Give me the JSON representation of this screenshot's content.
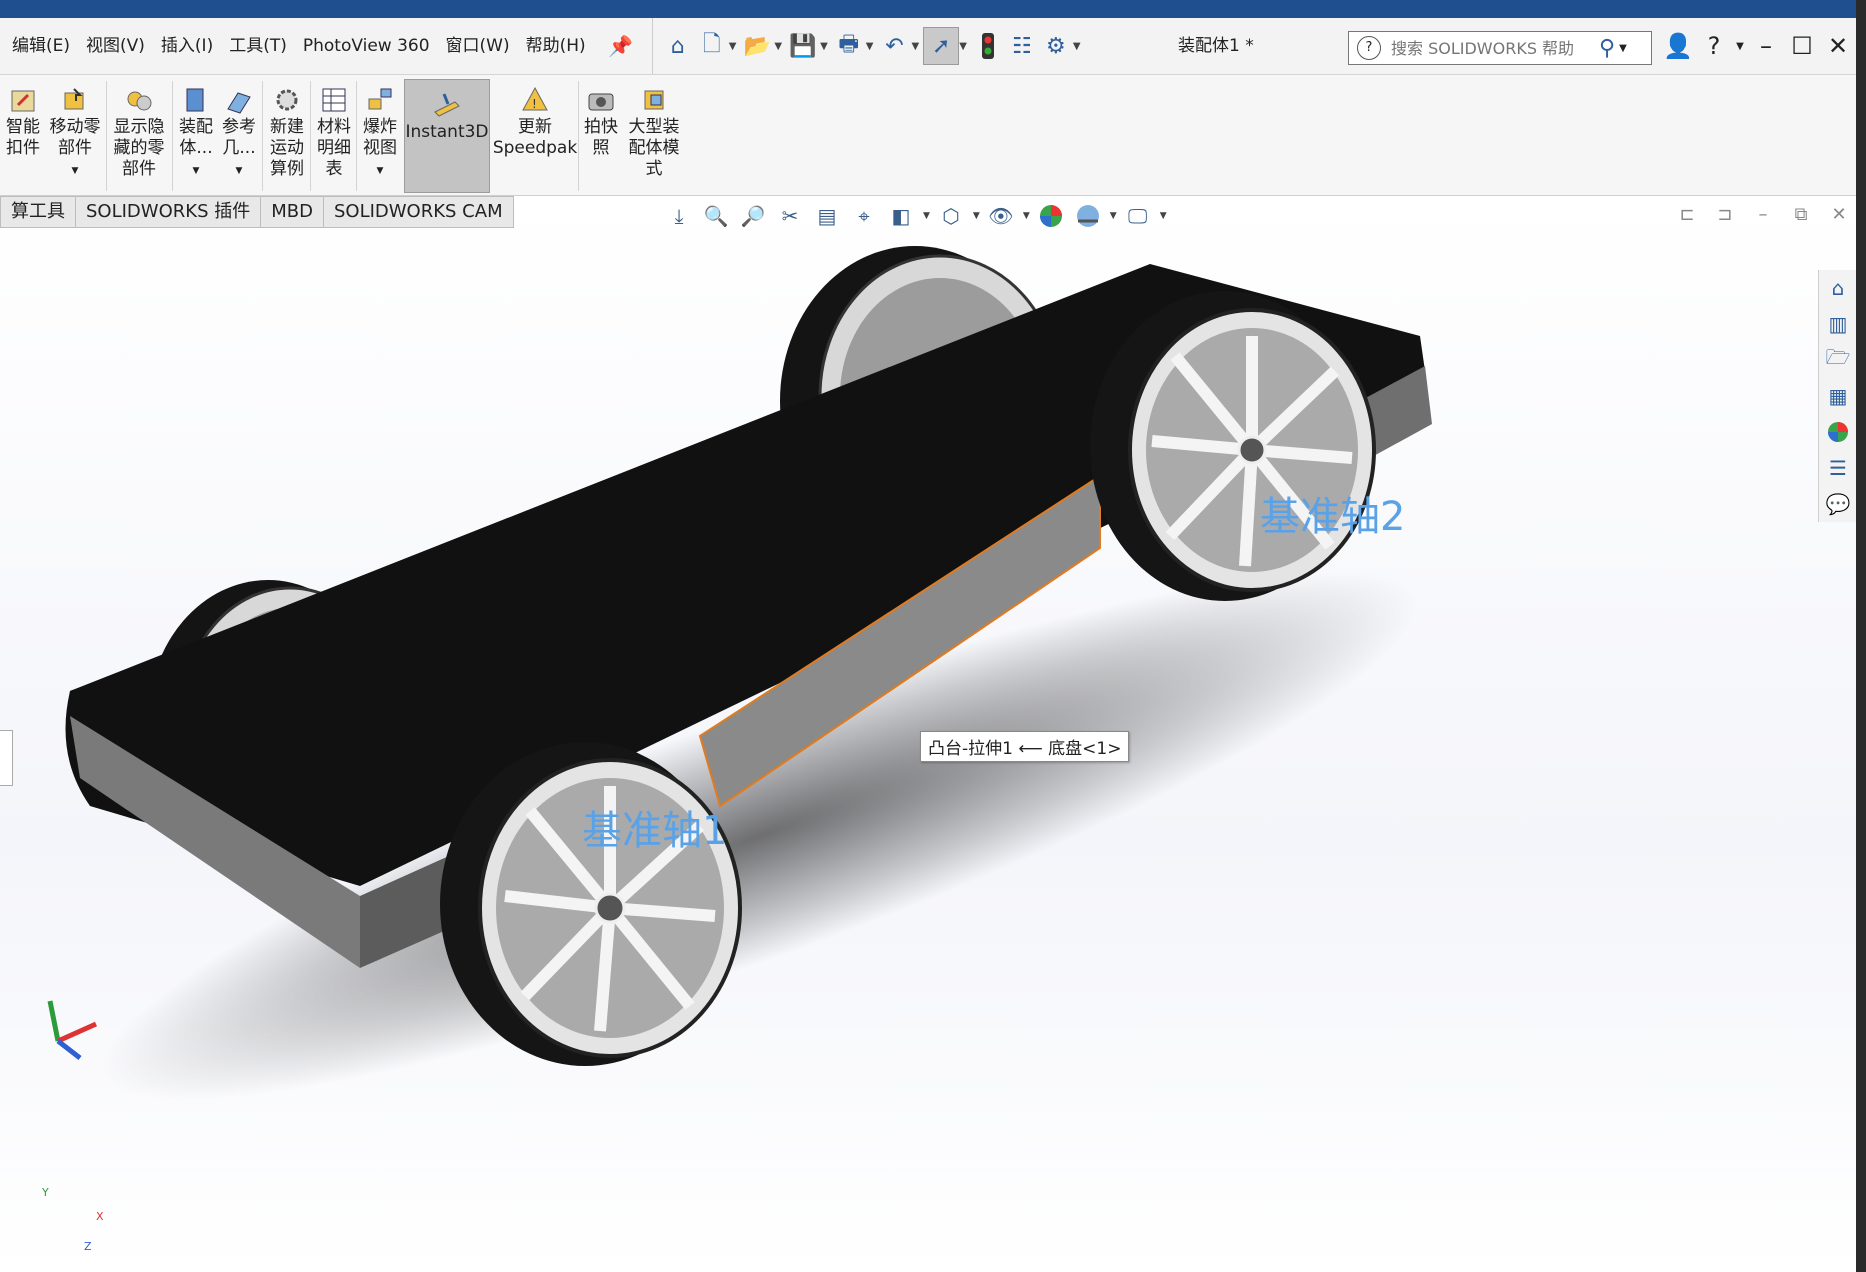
{
  "menu": [
    "编辑(E)",
    "视图(V)",
    "插入(I)",
    "工具(T)",
    "PhotoView 360",
    "窗口(W)",
    "帮助(H)"
  ],
  "document_title": "装配体1 *",
  "search": {
    "placeholder": "搜索 SOLIDWORKS 帮助"
  },
  "ribbon": [
    {
      "label": "智能\n扣件",
      "icon": "smart-fastener-icon"
    },
    {
      "label": "移动零\n部件",
      "icon": "move-component-icon"
    },
    {
      "label": "显示隐\n藏的零\n部件",
      "icon": "show-hidden-icon"
    },
    {
      "label": "装配\n体...",
      "icon": "assembly-features-icon"
    },
    {
      "label": "参考\n几...",
      "icon": "reference-geometry-icon"
    },
    {
      "label": "新建\n运动\n算例",
      "icon": "motion-study-icon"
    },
    {
      "label": "材料\n明细\n表",
      "icon": "bom-icon"
    },
    {
      "label": "爆炸\n视图",
      "icon": "explode-view-icon"
    },
    {
      "label": "Instant3D",
      "icon": "instant3d-icon"
    },
    {
      "label": "更新\nSpeedpak",
      "icon": "speedpak-icon"
    },
    {
      "label": "拍快\n照",
      "icon": "snapshot-icon"
    },
    {
      "label": "大型装\n配体模\n式",
      "icon": "large-assembly-icon"
    }
  ],
  "tabs": [
    "算工具",
    "SOLIDWORKS 插件",
    "MBD",
    "SOLIDWORKS CAM"
  ],
  "viewport": {
    "axis1_label": "基准轴1",
    "axis2_label": "基准轴2",
    "tooltip": "凸台-拉伸1 ⟵ 底盘<1>",
    "triad": {
      "x": "X",
      "y": "Y",
      "z": "Z"
    }
  },
  "colors": {
    "accent": "#2f5f9c",
    "body": "#111111",
    "highlight": "#e07b1f",
    "axis_text": "#5aa2e8"
  }
}
